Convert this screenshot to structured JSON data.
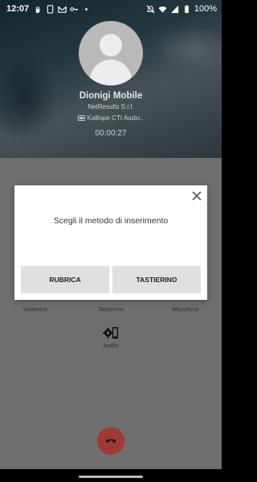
{
  "status_bar": {
    "time": "12:07",
    "battery": "100%"
  },
  "call": {
    "caller_name": "Dionigi Mobile",
    "caller_company": "NetResults S.r.l.",
    "line_label": "Kalliope CTI Audio..",
    "timer": "00:00:27"
  },
  "controls": {
    "vivavoce_label": "Vivavoce",
    "tastierino_label": "Tastierino",
    "microfono_label": "Microfono",
    "audio_label": "Audio"
  },
  "dialog": {
    "title": "Scegli il metodo di inserimento",
    "button_rubrica": "RUBRICA",
    "button_tastierino": "TASTIERINO"
  },
  "colors": {
    "hangup": "#a13a32",
    "dim_overlay": "#6f6f6f"
  }
}
